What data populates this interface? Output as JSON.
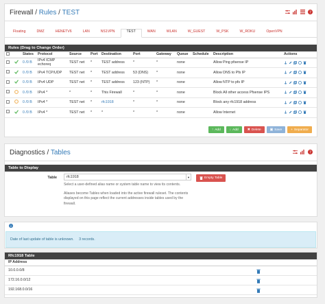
{
  "rules_panel": {
    "breadcrumb": [
      "Firewall",
      "Rules",
      "TEST"
    ],
    "tabs": [
      "Floating",
      "DMZ",
      "HENETV6",
      "LAN",
      "NS1VPN",
      "TEST",
      "WAN",
      "WLAN",
      "W_GUEST",
      "W_PSK",
      "W_ROKU",
      "OpenVPN"
    ],
    "active_tab": "TEST",
    "section_title": "Rules (Drag to Change Order)",
    "columns": [
      "",
      "",
      "States",
      "Protocol",
      "Source",
      "Port",
      "Destination",
      "Port",
      "Gateway",
      "Queue",
      "Schedule",
      "Description",
      "Actions"
    ],
    "rows": [
      {
        "status": "pass",
        "states": "0 /0 B",
        "protocol": "IPv4 ICMP echoreq",
        "source": "TEST net",
        "sport": "*",
        "destination": "TEST address",
        "dport": "*",
        "gateway": "*",
        "queue": "none",
        "schedule": "",
        "description": "Allow Ping pfsense IP"
      },
      {
        "status": "pass",
        "states": "0 /0 B",
        "protocol": "IPv4 TCP/UDP",
        "source": "TEST net",
        "sport": "*",
        "destination": "TEST address",
        "dport": "53 (DNS)",
        "gateway": "*",
        "queue": "none",
        "schedule": "",
        "description": "Allow DNS to Pfs IP"
      },
      {
        "status": "pass",
        "states": "0 /0 B",
        "protocol": "IPv4 UDP",
        "source": "TEST net",
        "sport": "*",
        "destination": "TEST address",
        "dport": "123 (NTP)",
        "gateway": "*",
        "queue": "none",
        "schedule": "",
        "description": "Allow NTP to pfs IP"
      },
      {
        "status": "block",
        "states": "0 /0 B",
        "protocol": "IPv4 *",
        "source": "*",
        "sport": "*",
        "destination": "This Firewall",
        "dport": "*",
        "gateway": "*",
        "queue": "none",
        "schedule": "",
        "description": "Block All other access Pfsense IPS"
      },
      {
        "status": "block",
        "states": "0 /0 B",
        "protocol": "IPv4 *",
        "source": "TEST net",
        "sport": "*",
        "destination": "rfc1918",
        "dport": "*",
        "gateway": "*",
        "queue": "none",
        "schedule": "",
        "description": "Block any rfc1918 address"
      },
      {
        "status": "pass",
        "states": "0 /0 B",
        "protocol": "IPv4 *",
        "source": "TEST net",
        "sport": "*",
        "destination": "*",
        "dport": "*",
        "gateway": "*",
        "queue": "none",
        "schedule": "",
        "description": "Allow Internet"
      }
    ],
    "buttons": {
      "add_top": "Add",
      "add_bottom": "Add",
      "delete": "Delete",
      "save": "Save",
      "separator": "Separator"
    }
  },
  "diag_panel": {
    "breadcrumb": [
      "Diagnostics",
      "Tables"
    ],
    "section_title": "Table to Display",
    "table_label": "Table",
    "table_selected": "rfc1918",
    "help_1": "Select a user-defined alias name or system table name to view its contents.",
    "help_2": "Aliases become Tables when loaded into the active firewall ruleset. The contents displayed on this page reflect the current addresses inside tables used by the firewall.",
    "empty_button": "Empty Table"
  },
  "info": {
    "message": "Date of last update of table is unknown.     3 records."
  },
  "rfc_panel": {
    "title": "Rfc1918 Table",
    "column": "IP Address",
    "addresses": [
      "10.0.0.0/8",
      "172.16.0.0/12",
      "192.168.0.0/16"
    ]
  },
  "colors": {
    "link": "#337ab7",
    "tab_red": "#c9302c",
    "bar_dark": "#424242",
    "pass_green": "#5cb85c",
    "block_yellow": "#f0ad4e",
    "add_green": "#5cb85c",
    "delete_red": "#d9534f",
    "save_blue": "#8fb3d9",
    "separator_orange": "#f0ad4e"
  }
}
